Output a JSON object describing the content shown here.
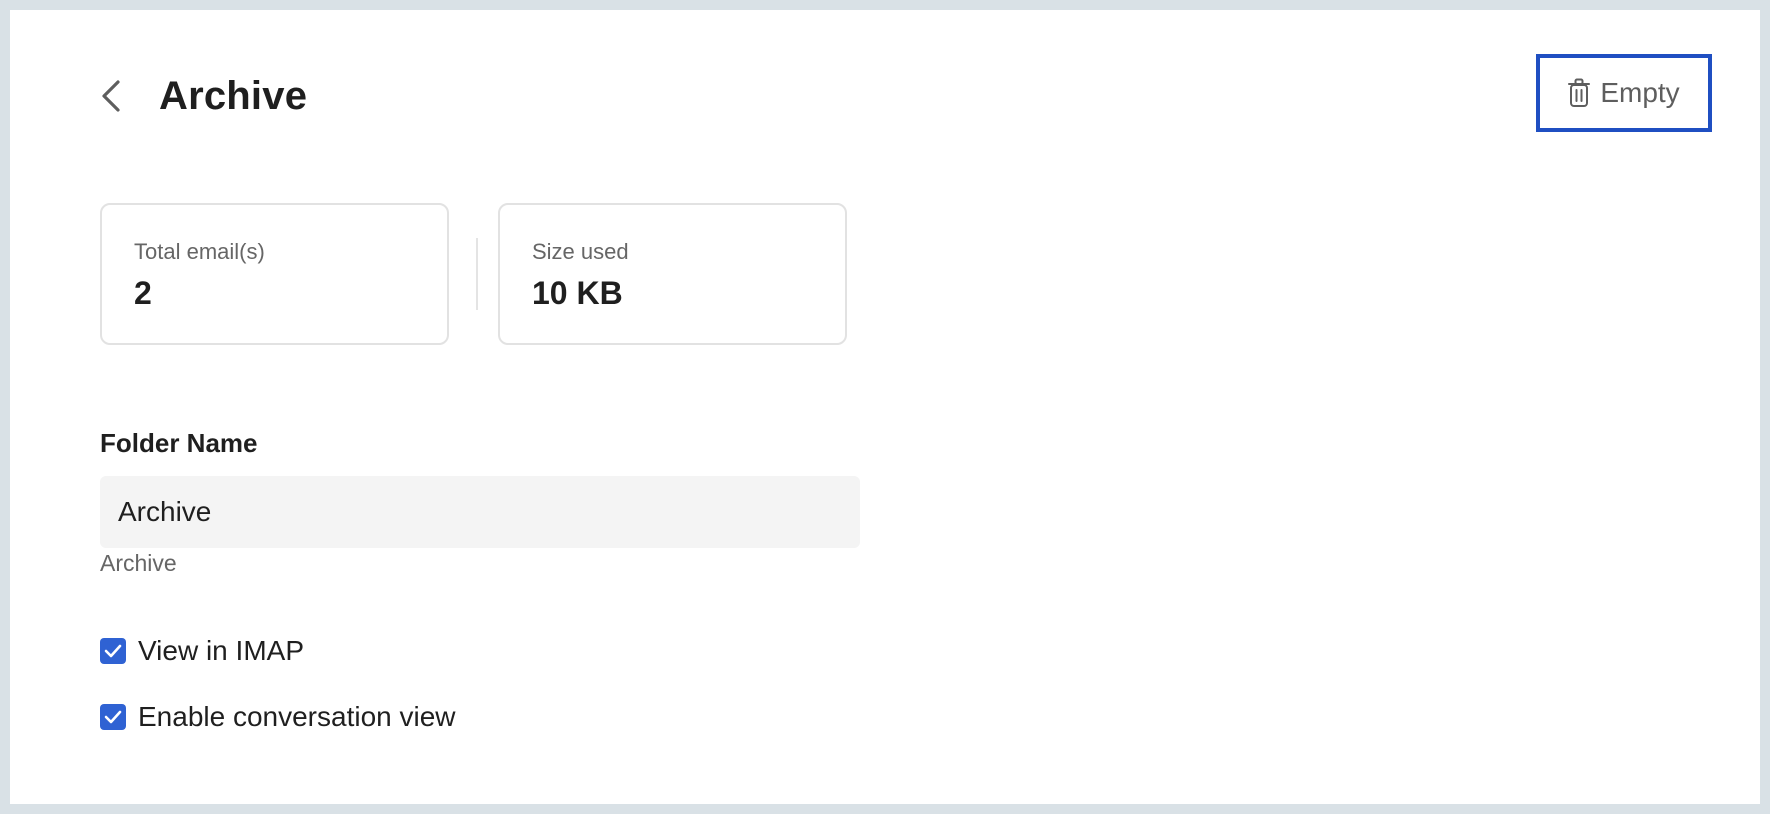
{
  "header": {
    "title": "Archive",
    "back_icon": "chevron-left-icon"
  },
  "actions": {
    "empty_label": "Empty",
    "empty_icon": "trash-icon",
    "focus_color": "#1f4fc2"
  },
  "stats": {
    "total_label": "Total email(s)",
    "total_value": "2",
    "size_label": "Size used",
    "size_value": "10 KB"
  },
  "form": {
    "folder_name_label": "Folder Name",
    "folder_name_value": "Archive",
    "folder_name_helper": "Archive"
  },
  "options": {
    "view_in_imap": {
      "label": "View in IMAP",
      "checked": true
    },
    "conversation_view": {
      "label": "Enable conversation view",
      "checked": true
    },
    "checkbox_color": "#2f62d3"
  }
}
